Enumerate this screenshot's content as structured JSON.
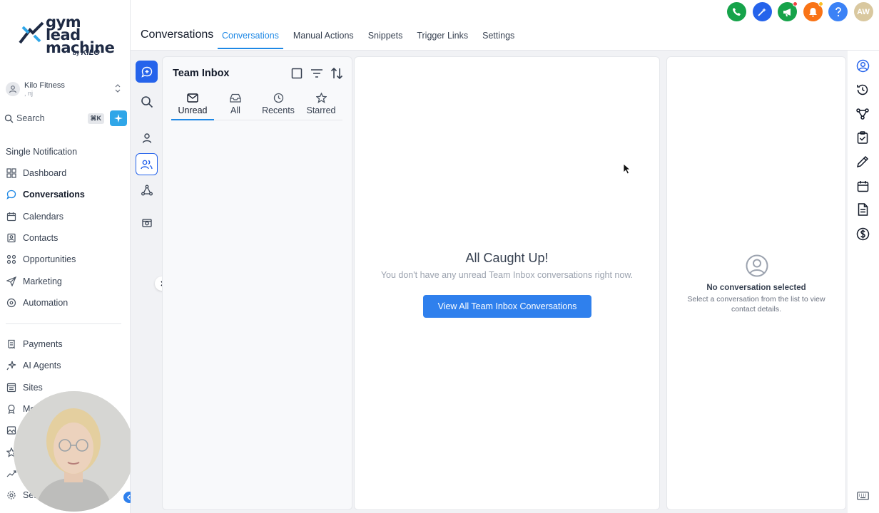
{
  "brand": {
    "logo_line1": "gym lead",
    "logo_line2": "machine",
    "by": "by",
    "by_brand": "KILO"
  },
  "account": {
    "name": "Kilo Fitness",
    "sub": ", nj"
  },
  "search": {
    "label": "Search",
    "shortcut": "⌘K"
  },
  "sidebar": {
    "section_title": "Single Notification",
    "items": [
      {
        "label": "Dashboard",
        "icon": "dashboard-icon"
      },
      {
        "label": "Conversations",
        "icon": "chat-icon",
        "active": true
      },
      {
        "label": "Calendars",
        "icon": "calendar-icon"
      },
      {
        "label": "Contacts",
        "icon": "contacts-icon"
      },
      {
        "label": "Opportunities",
        "icon": "opportunities-icon"
      },
      {
        "label": "Marketing",
        "icon": "send-icon"
      },
      {
        "label": "Automation",
        "icon": "automation-icon"
      }
    ],
    "items2": [
      {
        "label": "Payments",
        "icon": "payments-icon"
      },
      {
        "label": "AI Agents",
        "icon": "ai-agents-icon"
      },
      {
        "label": "Sites",
        "icon": "sites-icon"
      },
      {
        "label": "Me",
        "icon": "memberships-icon"
      },
      {
        "label": "",
        "icon": "media-icon"
      },
      {
        "label": "",
        "icon": "star-icon"
      },
      {
        "label": "",
        "icon": "trend-icon"
      },
      {
        "label": "Set",
        "icon": "settings-icon"
      }
    ]
  },
  "header": {
    "title": "Conversations",
    "tabs": [
      "Conversations",
      "Manual Actions",
      "Snippets",
      "Trigger Links",
      "Settings"
    ],
    "avatar_initials": "AW"
  },
  "colors": {
    "accent": "#1e88e5",
    "button": "#2f80ed",
    "phone": "#16a34a",
    "bell": "#f97316",
    "help": "#3b82f6"
  },
  "inbox": {
    "title": "Team Inbox",
    "filters": [
      {
        "label": "Unread",
        "icon": "mail-icon"
      },
      {
        "label": "All",
        "icon": "inbox-icon"
      },
      {
        "label": "Recents",
        "icon": "clock-icon"
      },
      {
        "label": "Starred",
        "icon": "star-icon"
      }
    ]
  },
  "empty_state": {
    "title": "All Caught Up!",
    "subtitle": "You don't have any unread Team Inbox conversations right now.",
    "button": "View All Team Inbox Conversations"
  },
  "details": {
    "title": "No conversation selected",
    "subtitle": "Select a conversation from the list to view contact details."
  }
}
